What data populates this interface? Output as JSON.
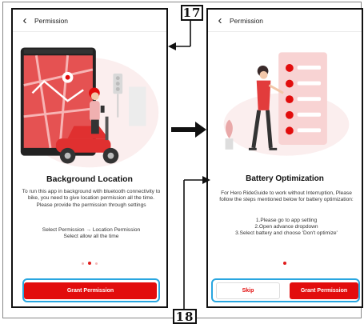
{
  "left_screen": {
    "header_title": "Permission",
    "title": "Background Location",
    "paragraph": "To run this app in background with bluetooth connectivity to bike, you need to give location permission all the time. Please provide the permission through settings",
    "instruction_line1": "Select Permission → Location Permission",
    "instruction_line2": "Select allow all the time",
    "pager": {
      "total": 3,
      "active_index": 1
    },
    "grant_button_label": "Grant Permission"
  },
  "right_screen": {
    "header_title": "Permission",
    "title": "Battery Optimization",
    "paragraph": "For Hero RideGuide to work without Interruption, Please follow the steps mentioned below for battery optimization:",
    "steps": [
      "1.Please go to app setting",
      "2.Open advance dropdown",
      "3.Select battery and choose 'Don't optimize'"
    ],
    "pager": {
      "total": 1,
      "active_index": 0
    },
    "skip_button_label": "Skip",
    "grant_button_label": "Grant Permission"
  },
  "callouts": {
    "label_17": "17",
    "label_18": "18"
  },
  "colors": {
    "accent_red": "#e20d0d",
    "highlight_blue": "#29a6e0",
    "illustration_pink": "#f6c9c9"
  }
}
